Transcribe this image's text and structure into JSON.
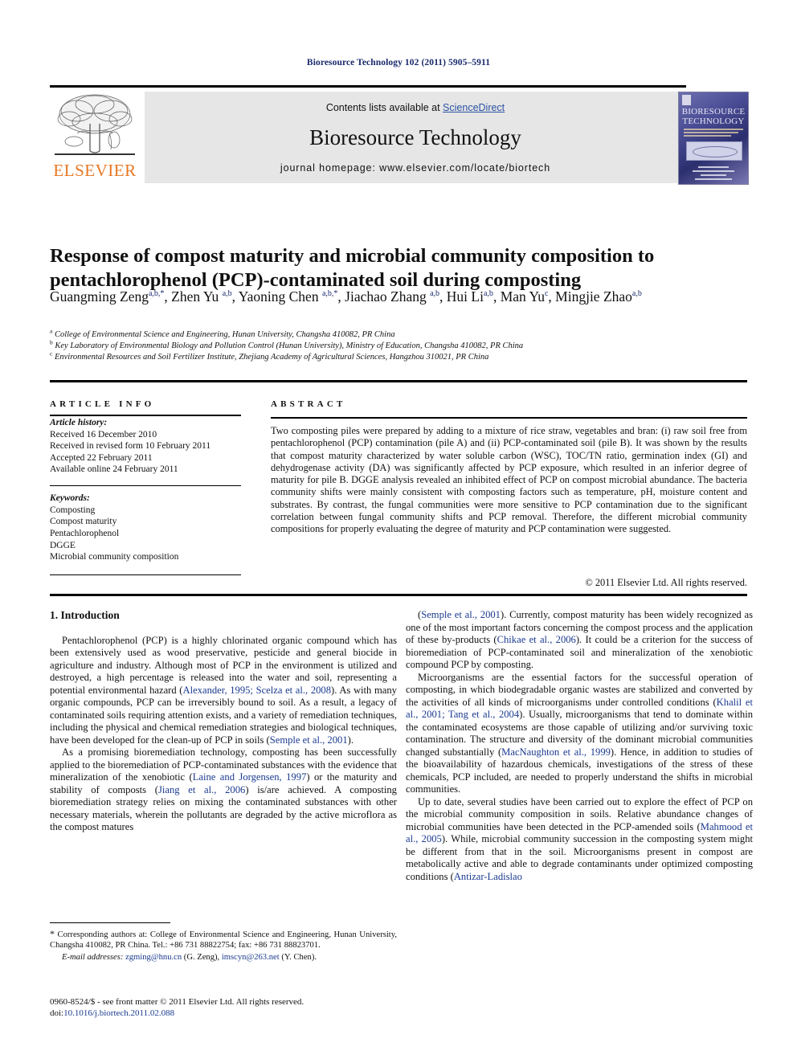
{
  "running_head": "Bioresource Technology 102 (2011) 5905–5911",
  "masthead": {
    "contents_prefix": "Contents lists available at ",
    "sciencedirect": "ScienceDirect",
    "journal_title": "Bioresource Technology",
    "homepage": "journal homepage: www.elsevier.com/locate/biortech",
    "publisher_logo_text": "ELSEVIER",
    "cover_title_line1": "BIORESOURCE",
    "cover_title_line2": "TECHNOLOGY",
    "accent_color": "#E87722",
    "link_color": "#2952a3"
  },
  "article": {
    "title": "Response of compost maturity and microbial community composition to pentachlorophenol (PCP)-contaminated soil during composting",
    "authors_html": "Guangming Zeng<sup>a,b,</sup><sup>*</sup>, Zhen Yu <sup>a,b</sup>, Yaoning Chen <sup>a,b,</sup><sup>*</sup>, Jiachao Zhang <sup>a,b</sup>, Hui Li<sup>a,b</sup>, Man Yu<sup>c</sup>, Mingjie Zhao<sup>a,b</sup>",
    "affiliations": [
      {
        "mark": "a",
        "text": "College of Environmental Science and Engineering, Hunan University, Changsha 410082, PR China"
      },
      {
        "mark": "b",
        "text": "Key Laboratory of Environmental Biology and Pollution Control (Hunan University), Ministry of Education, Changsha 410082, PR China"
      },
      {
        "mark": "c",
        "text": "Environmental Resources and Soil Fertilizer Institute, Zhejiang Academy of Agricultural Sciences, Hangzhou 310021, PR China"
      }
    ]
  },
  "article_info": {
    "heading": "ARTICLE INFO",
    "history_label": "Article history:",
    "history": [
      "Received 16 December 2010",
      "Received in revised form 10 February 2011",
      "Accepted 22 February 2011",
      "Available online 24 February 2011"
    ],
    "keywords_label": "Keywords:",
    "keywords": [
      "Composting",
      "Compost maturity",
      "Pentachlorophenol",
      "DGGE",
      "Microbial community composition"
    ]
  },
  "abstract": {
    "heading": "ABSTRACT",
    "text": "Two composting piles were prepared by adding to a mixture of rice straw, vegetables and bran: (i) raw soil free from pentachlorophenol (PCP) contamination (pile A) and (ii) PCP-contaminated soil (pile B). It was shown by the results that compost maturity characterized by water soluble carbon (WSC), TOC/TN ratio, germination index (GI) and dehydrogenase activity (DA) was significantly affected by PCP exposure, which resulted in an inferior degree of maturity for pile B. DGGE analysis revealed an inhibited effect of PCP on compost microbial abundance. The bacteria community shifts were mainly consistent with composting factors such as temperature, pH, moisture content and substrates. By contrast, the fungal communities were more sensitive to PCP contamination due to the significant correlation between fungal community shifts and PCP removal. Therefore, the different microbial community compositions for properly evaluating the degree of maturity and PCP contamination were suggested.",
    "copyright": "© 2011 Elsevier Ltd. All rights reserved."
  },
  "body": {
    "section_heading": "1. Introduction",
    "left_paragraphs_html": [
      "Pentachlorophenol (PCP) is a highly chlorinated organic compound which has been extensively used as wood preservative, pesticide and general biocide in agriculture and industry. Although most of PCP in the environment is utilized and destroyed, a high percentage is released into the water and soil, representing a potential environmental hazard (<span class=\"ref\">Alexander, 1995; Scelza et al., 2008</span>). As with many organic compounds, PCP can be irreversibly bound to soil. As a result, a legacy of contaminated soils requiring attention exists, and a variety of remediation techniques, including the physical and chemical remediation strategies and biological techniques, have been developed for the clean-up of PCP in soils (<span class=\"ref\">Semple et al., 2001</span>).",
      "As a promising bioremediation technology, composting has been successfully applied to the bioremediation of PCP-contaminated substances with the evidence that mineralization of the xenobiotic (<span class=\"ref\">Laine and Jorgensen, 1997</span>) or the maturity and stability of composts (<span class=\"ref\">Jiang et al., 2006</span>) is/are achieved. A composting bioremediation strategy relies on mixing the contaminated substances with other necessary materials, wherein the pollutants are degraded by the active microflora as the compost matures"
    ],
    "right_paragraphs_html": [
      "(<span class=\"ref\">Semple et al., 2001</span>). Currently, compost maturity has been widely recognized as one of the most important factors concerning the compost process and the application of these by-products (<span class=\"ref\">Chikae et al., 2006</span>). It could be a criterion for the success of bioremediation of PCP-contaminated soil and mineralization of the xenobiotic compound PCP by composting.",
      "Microorganisms are the essential factors for the successful operation of composting, in which biodegradable organic wastes are stabilized and converted by the activities of all kinds of microorganisms under controlled conditions (<span class=\"ref\">Khalil et al., 2001; Tang et al., 2004</span>). Usually, microorganisms that tend to dominate within the contaminated ecosystems are those capable of utilizing and/or surviving toxic contamination. The structure and diversity of the dominant microbial communities changed substantially (<span class=\"ref\">MacNaughton et al., 1999</span>). Hence, in addition to studies of the bioavailability of hazardous chemicals, investigations of the stress of these chemicals, PCP included, are needed to properly understand the shifts in microbial communities.",
      "Up to date, several studies have been carried out to explore the effect of PCP on the microbial community composition in soils. Relative abundance changes of microbial communities have been detected in the PCP-amended soils (<span class=\"ref\">Mahmood et al., 2005</span>). While, microbial community succession in the composting system might be different from that in the soil. Microorganisms present in compost are metabolically active and able to degrade contaminants under optimized composting conditions (<span class=\"ref\">Antizar-Ladislao</span>"
    ]
  },
  "footnotes": {
    "corresponding_html": "<span style=\"font-size:12px\">*</span> Corresponding authors at: College of Environmental Science and Engineering, Hunan University, Changsha 410082, PR China. Tel.: +86 731 88822754; fax: +86 731 88823701.",
    "email_html": "<span class=\"ital\">E-mail addresses:</span> <span class=\"ref\">zgming@hnu.cn</span> (G. Zeng), <span class=\"ref\">imscyn@263.net</span> (Y. Chen).",
    "imprint_line1_html": "0960-8524/$ - see front matter © 2011 Elsevier Ltd. All rights reserved.",
    "imprint_line2_html": "doi:<span class=\"ref\">10.1016/j.biortech.2011.02.088</span>"
  }
}
